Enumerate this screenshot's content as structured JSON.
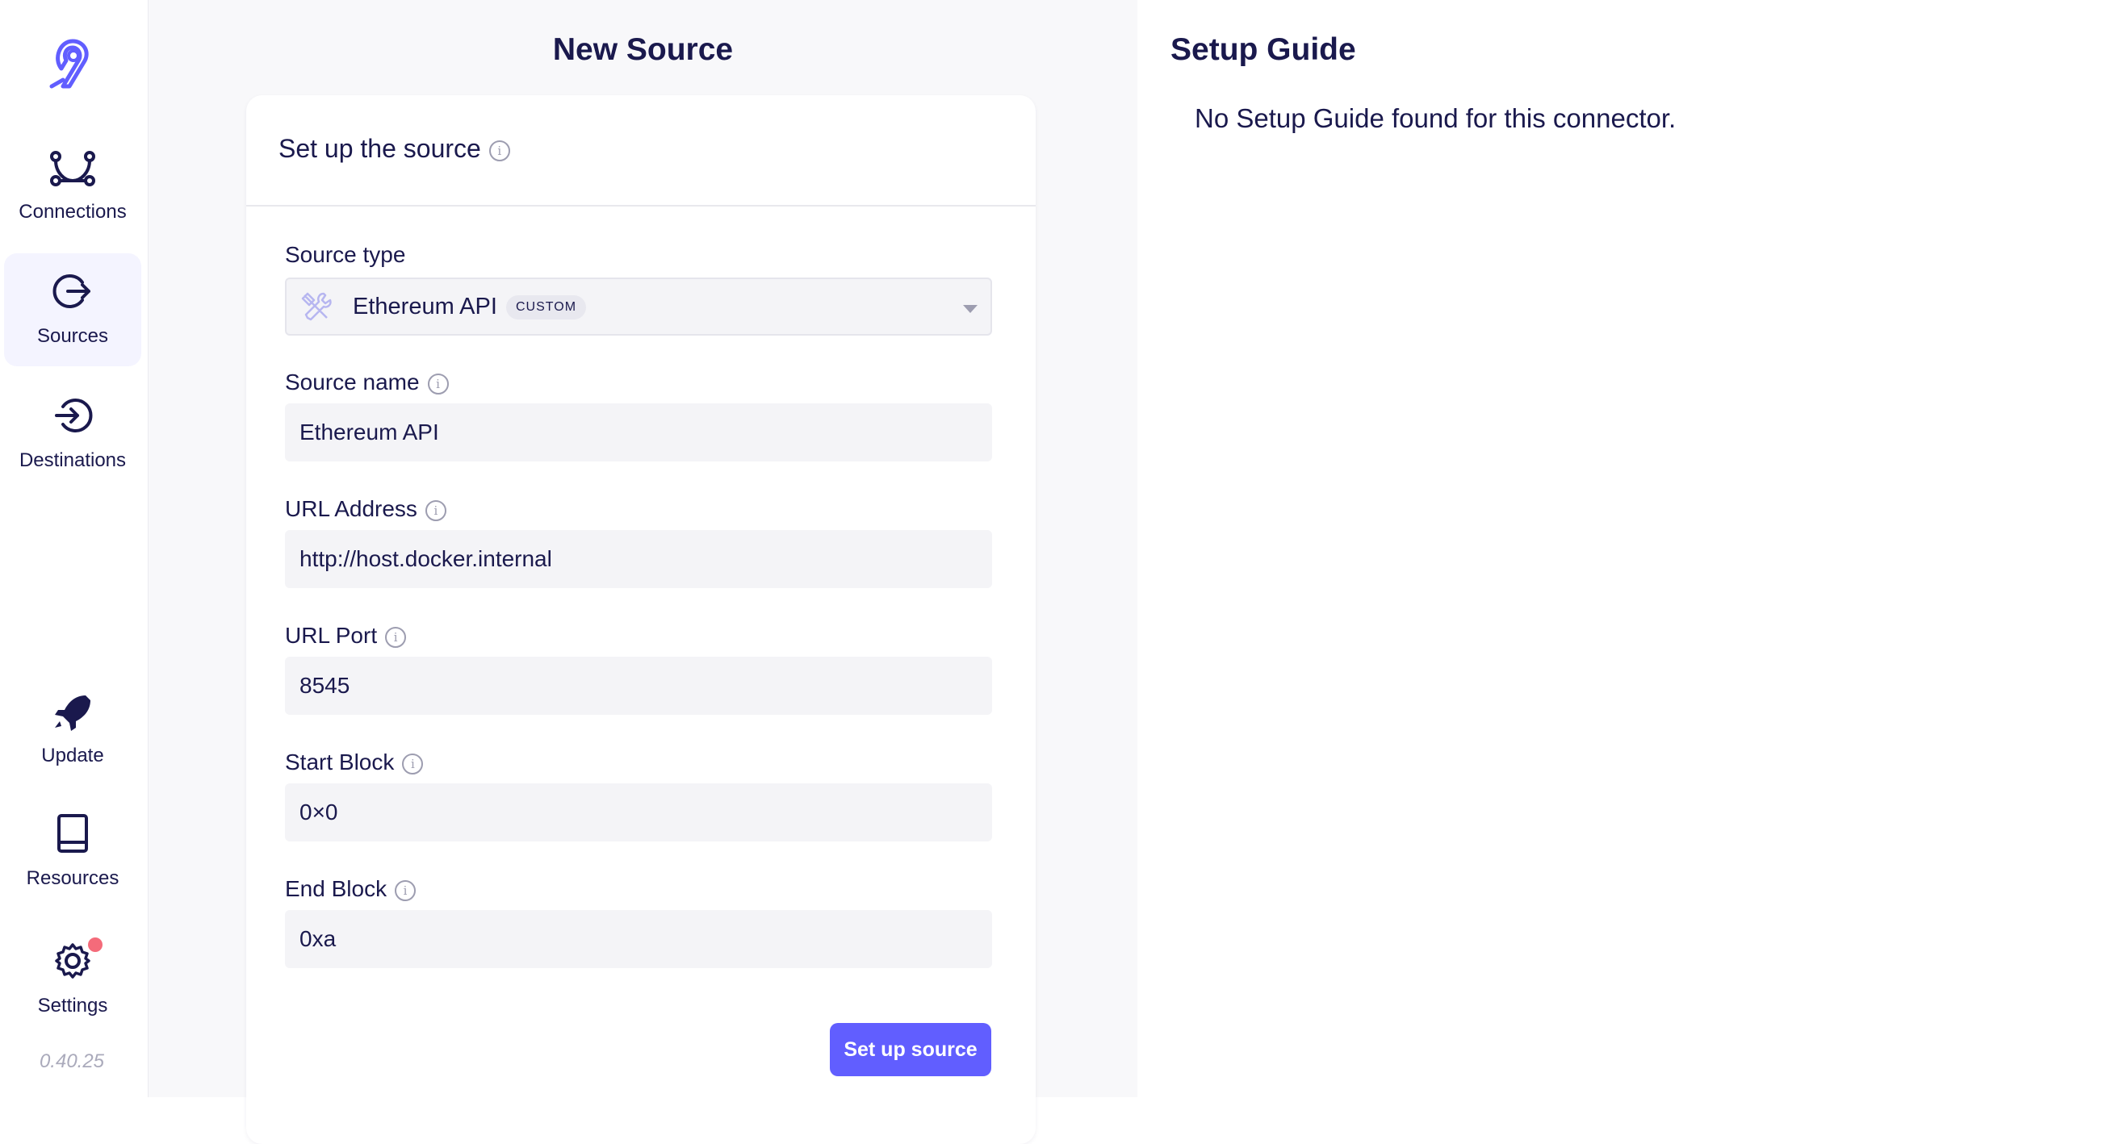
{
  "sidebar": {
    "logo_icon": "airbyte-logo-icon",
    "items": [
      {
        "label": "Connections",
        "icon": "connections-icon",
        "active": false
      },
      {
        "label": "Sources",
        "icon": "sources-icon",
        "active": true
      },
      {
        "label": "Destinations",
        "icon": "destinations-icon",
        "active": false
      }
    ],
    "bottom_items": [
      {
        "label": "Update",
        "icon": "rocket-icon"
      },
      {
        "label": "Resources",
        "icon": "book-icon"
      },
      {
        "label": "Settings",
        "icon": "gear-icon",
        "notification": true
      }
    ],
    "version": "0.40.25"
  },
  "main": {
    "title": "New Source",
    "card": {
      "title": "Set up the source",
      "source_type": {
        "label": "Source type",
        "value": "Ethereum API",
        "tag": "CUSTOM"
      },
      "fields": [
        {
          "label": "Source name",
          "value": "Ethereum API"
        },
        {
          "label": "URL Address",
          "value": "http://host.docker.internal"
        },
        {
          "label": "URL Port",
          "value": "8545"
        },
        {
          "label": "Start Block",
          "value": "0×0"
        },
        {
          "label": "End Block",
          "value": "0xa"
        }
      ],
      "submit_label": "Set up source"
    }
  },
  "guide": {
    "title": "Setup Guide",
    "text": "No Setup Guide found for this connector."
  },
  "colors": {
    "primary": "#615eff",
    "text": "#1a194d",
    "active_nav_bg": "#f4f4ff",
    "notification": "#f46b7a",
    "main_bg": "#f8f8fa"
  }
}
